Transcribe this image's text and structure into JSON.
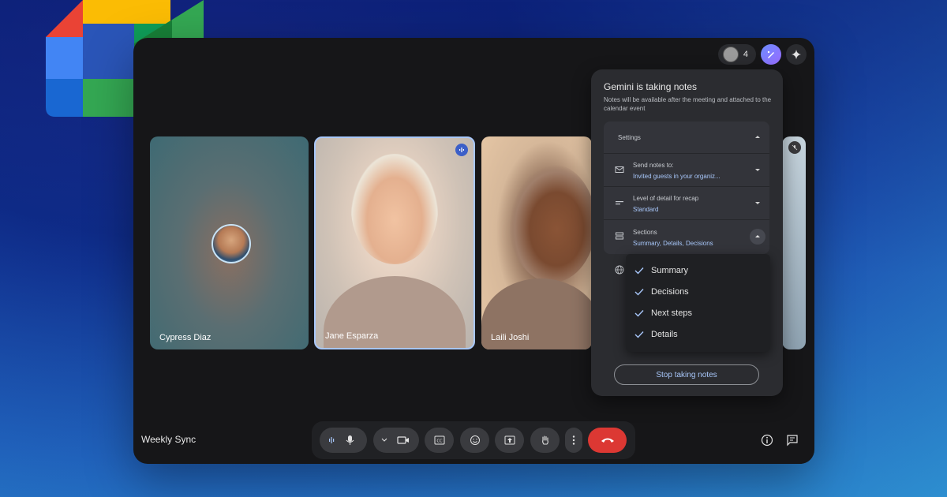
{
  "app": {
    "name": "Google Meet"
  },
  "window": {
    "participant_count": "4",
    "meeting_title": "Weekly Sync"
  },
  "tiles": [
    {
      "name": "Cypress Diaz"
    },
    {
      "name": "Jane Esparza"
    },
    {
      "name": "Laili Joshi"
    }
  ],
  "gemini": {
    "title": "Gemini is taking notes",
    "subtitle": "Notes will be available after the meeting and attached to the calendar event",
    "settings_label": "Settings",
    "send_notes_label": "Send notes to:",
    "send_notes_value": "Invited guests in your organiz...",
    "detail_label": "Level of detail for recap",
    "detail_value": "Standard",
    "sections_label": "Sections",
    "sections_value": "Summary, Details, Decisions",
    "section_options": [
      "Summary",
      "Decisions",
      "Next steps",
      "Details"
    ],
    "stop_label": "Stop taking notes"
  },
  "colors": {
    "accent_blue": "#a8c7fa",
    "end_call_red": "#dc3833",
    "panel_bg": "#2b2c30"
  }
}
